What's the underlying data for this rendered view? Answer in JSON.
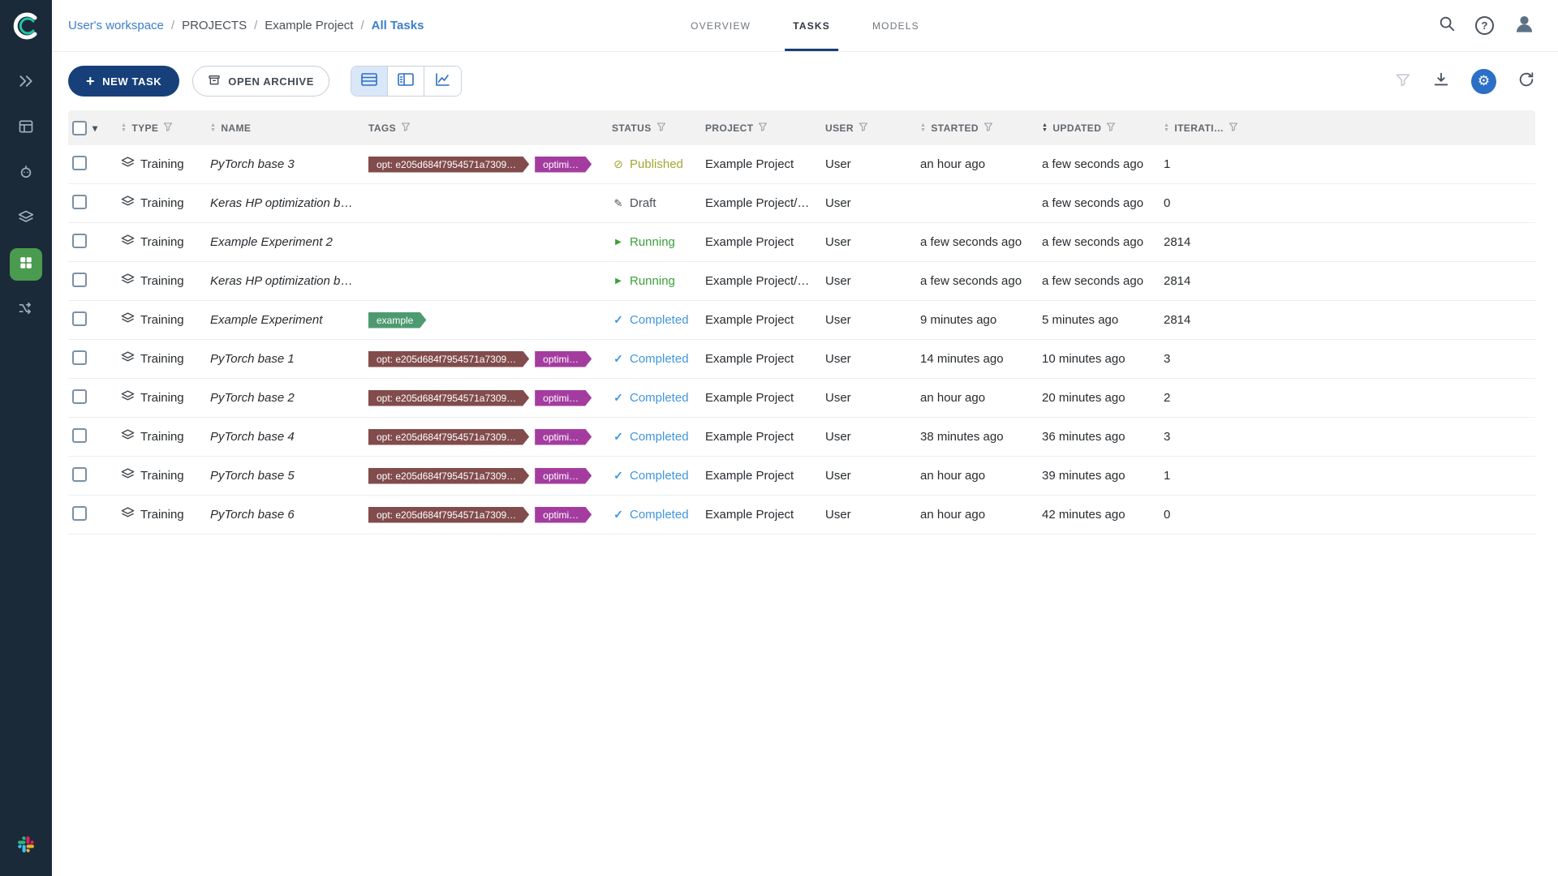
{
  "header": {
    "breadcrumb": [
      {
        "label": "User's workspace"
      },
      {
        "label": "PROJECTS"
      },
      {
        "label": "Example Project"
      },
      {
        "label": "All Tasks"
      }
    ],
    "separator": "/",
    "tabs": [
      {
        "label": "OVERVIEW",
        "active": false
      },
      {
        "label": "TASKS",
        "active": true
      },
      {
        "label": "MODELS",
        "active": false
      }
    ]
  },
  "toolbar": {
    "new_task_label": "NEW TASK",
    "open_archive_label": "OPEN ARCHIVE"
  },
  "icons": {
    "caret": "▾",
    "sort_up": "▲",
    "sort_down": "▼",
    "status": {
      "published": "⊘",
      "draft": "✎",
      "running": "▶",
      "completed": "✓"
    }
  },
  "status_colors": {
    "published": "#a3a832",
    "draft": "#4a5057",
    "running": "#3ba03b",
    "completed": "#4096dd"
  },
  "table": {
    "columns": [
      {
        "key": "select",
        "label": "",
        "type": "select"
      },
      {
        "key": "type",
        "label": "TYPE",
        "sort": true,
        "filter": true
      },
      {
        "key": "name",
        "label": "NAME",
        "sort": true,
        "filter": false
      },
      {
        "key": "tags",
        "label": "TAGS",
        "sort": false,
        "filter": true
      },
      {
        "key": "status",
        "label": "STATUS",
        "sort": false,
        "filter": true
      },
      {
        "key": "project",
        "label": "PROJECT",
        "sort": false,
        "filter": true
      },
      {
        "key": "user",
        "label": "USER",
        "sort": false,
        "filter": true
      },
      {
        "key": "started",
        "label": "STARTED",
        "sort": true,
        "filter": true
      },
      {
        "key": "updated",
        "label": "UPDATED",
        "sort": true,
        "sort_active": true,
        "filter": true
      },
      {
        "key": "iterations",
        "label": "ITERATI…",
        "sort": true,
        "filter": true
      }
    ],
    "tag_defs": {
      "opt": {
        "label": "opt: e205d684f7954571a7309…",
        "color": "#824c4c"
      },
      "optimizer": {
        "label": "optimi…",
        "color": "#a43c9f"
      },
      "example": {
        "label": "example",
        "color": "#4e9a70"
      }
    },
    "rows": [
      {
        "type": "Training",
        "name": "PyTorch base 3",
        "tags": [
          "opt",
          "optimizer"
        ],
        "status": "published",
        "status_label": "Published",
        "project": "Example Project",
        "user": "User",
        "started": "an hour ago",
        "updated": "a few seconds ago",
        "iterations": "1"
      },
      {
        "type": "Training",
        "name": "Keras HP optimization base",
        "tags": [],
        "status": "draft",
        "status_label": "Draft",
        "project": "Example Project/Hy…",
        "user": "User",
        "started": "",
        "updated": "a few seconds ago",
        "iterations": "0"
      },
      {
        "type": "Training",
        "name": "Example Experiment 2",
        "tags": [],
        "status": "running",
        "status_label": "Running",
        "project": "Example Project",
        "user": "User",
        "started": "a few seconds ago",
        "updated": "a few seconds ago",
        "iterations": "2814"
      },
      {
        "type": "Training",
        "name": "Keras HP optimization base",
        "tags": [],
        "status": "running",
        "status_label": "Running",
        "project": "Example Project/Hy…",
        "user": "User",
        "started": "a few seconds ago",
        "updated": "a few seconds ago",
        "iterations": "2814"
      },
      {
        "type": "Training",
        "name": "Example Experiment",
        "tags": [
          "example"
        ],
        "status": "completed",
        "status_label": "Completed",
        "project": "Example Project",
        "user": "User",
        "started": "9 minutes ago",
        "updated": "5 minutes ago",
        "iterations": "2814"
      },
      {
        "type": "Training",
        "name": "PyTorch base 1",
        "tags": [
          "opt",
          "optimizer"
        ],
        "status": "completed",
        "status_label": "Completed",
        "project": "Example Project",
        "user": "User",
        "started": "14 minutes ago",
        "updated": "10 minutes ago",
        "iterations": "3"
      },
      {
        "type": "Training",
        "name": "PyTorch base 2",
        "tags": [
          "opt",
          "optimizer"
        ],
        "status": "completed",
        "status_label": "Completed",
        "project": "Example Project",
        "user": "User",
        "started": "an hour ago",
        "updated": "20 minutes ago",
        "iterations": "2"
      },
      {
        "type": "Training",
        "name": "PyTorch base 4",
        "tags": [
          "opt",
          "optimizer"
        ],
        "status": "completed",
        "status_label": "Completed",
        "project": "Example Project",
        "user": "User",
        "started": "38 minutes ago",
        "updated": "36 minutes ago",
        "iterations": "3"
      },
      {
        "type": "Training",
        "name": "PyTorch base 5",
        "tags": [
          "opt",
          "optimizer"
        ],
        "status": "completed",
        "status_label": "Completed",
        "project": "Example Project",
        "user": "User",
        "started": "an hour ago",
        "updated": "39 minutes ago",
        "iterations": "1"
      },
      {
        "type": "Training",
        "name": "PyTorch base 6",
        "tags": [
          "opt",
          "optimizer"
        ],
        "status": "completed",
        "status_label": "Completed",
        "project": "Example Project",
        "user": "User",
        "started": "an hour ago",
        "updated": "42 minutes ago",
        "iterations": "0"
      }
    ]
  }
}
